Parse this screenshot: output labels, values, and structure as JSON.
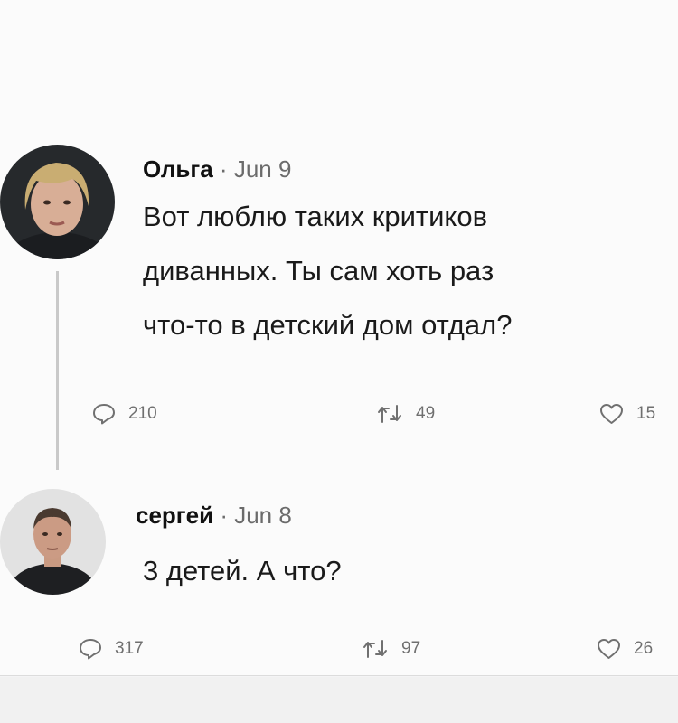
{
  "tweets": [
    {
      "author": "Ольга",
      "separator": "·",
      "date": "Jun 9",
      "lines": [
        "Вот люблю таких критиков",
        "диванных. Ты сам хоть раз",
        "что-то в детский дом отдал?"
      ],
      "replies": "210",
      "retweets": "49",
      "likes": "15"
    },
    {
      "author": "сергей",
      "separator": "·",
      "date": "Jun 8",
      "lines": [
        "3 детей. А что?"
      ],
      "replies": "317",
      "retweets": "97",
      "likes": "26"
    }
  ],
  "icons": {
    "reply": "speech-bubble-icon",
    "retweet": "retweet-icon",
    "like": "heart-icon"
  }
}
